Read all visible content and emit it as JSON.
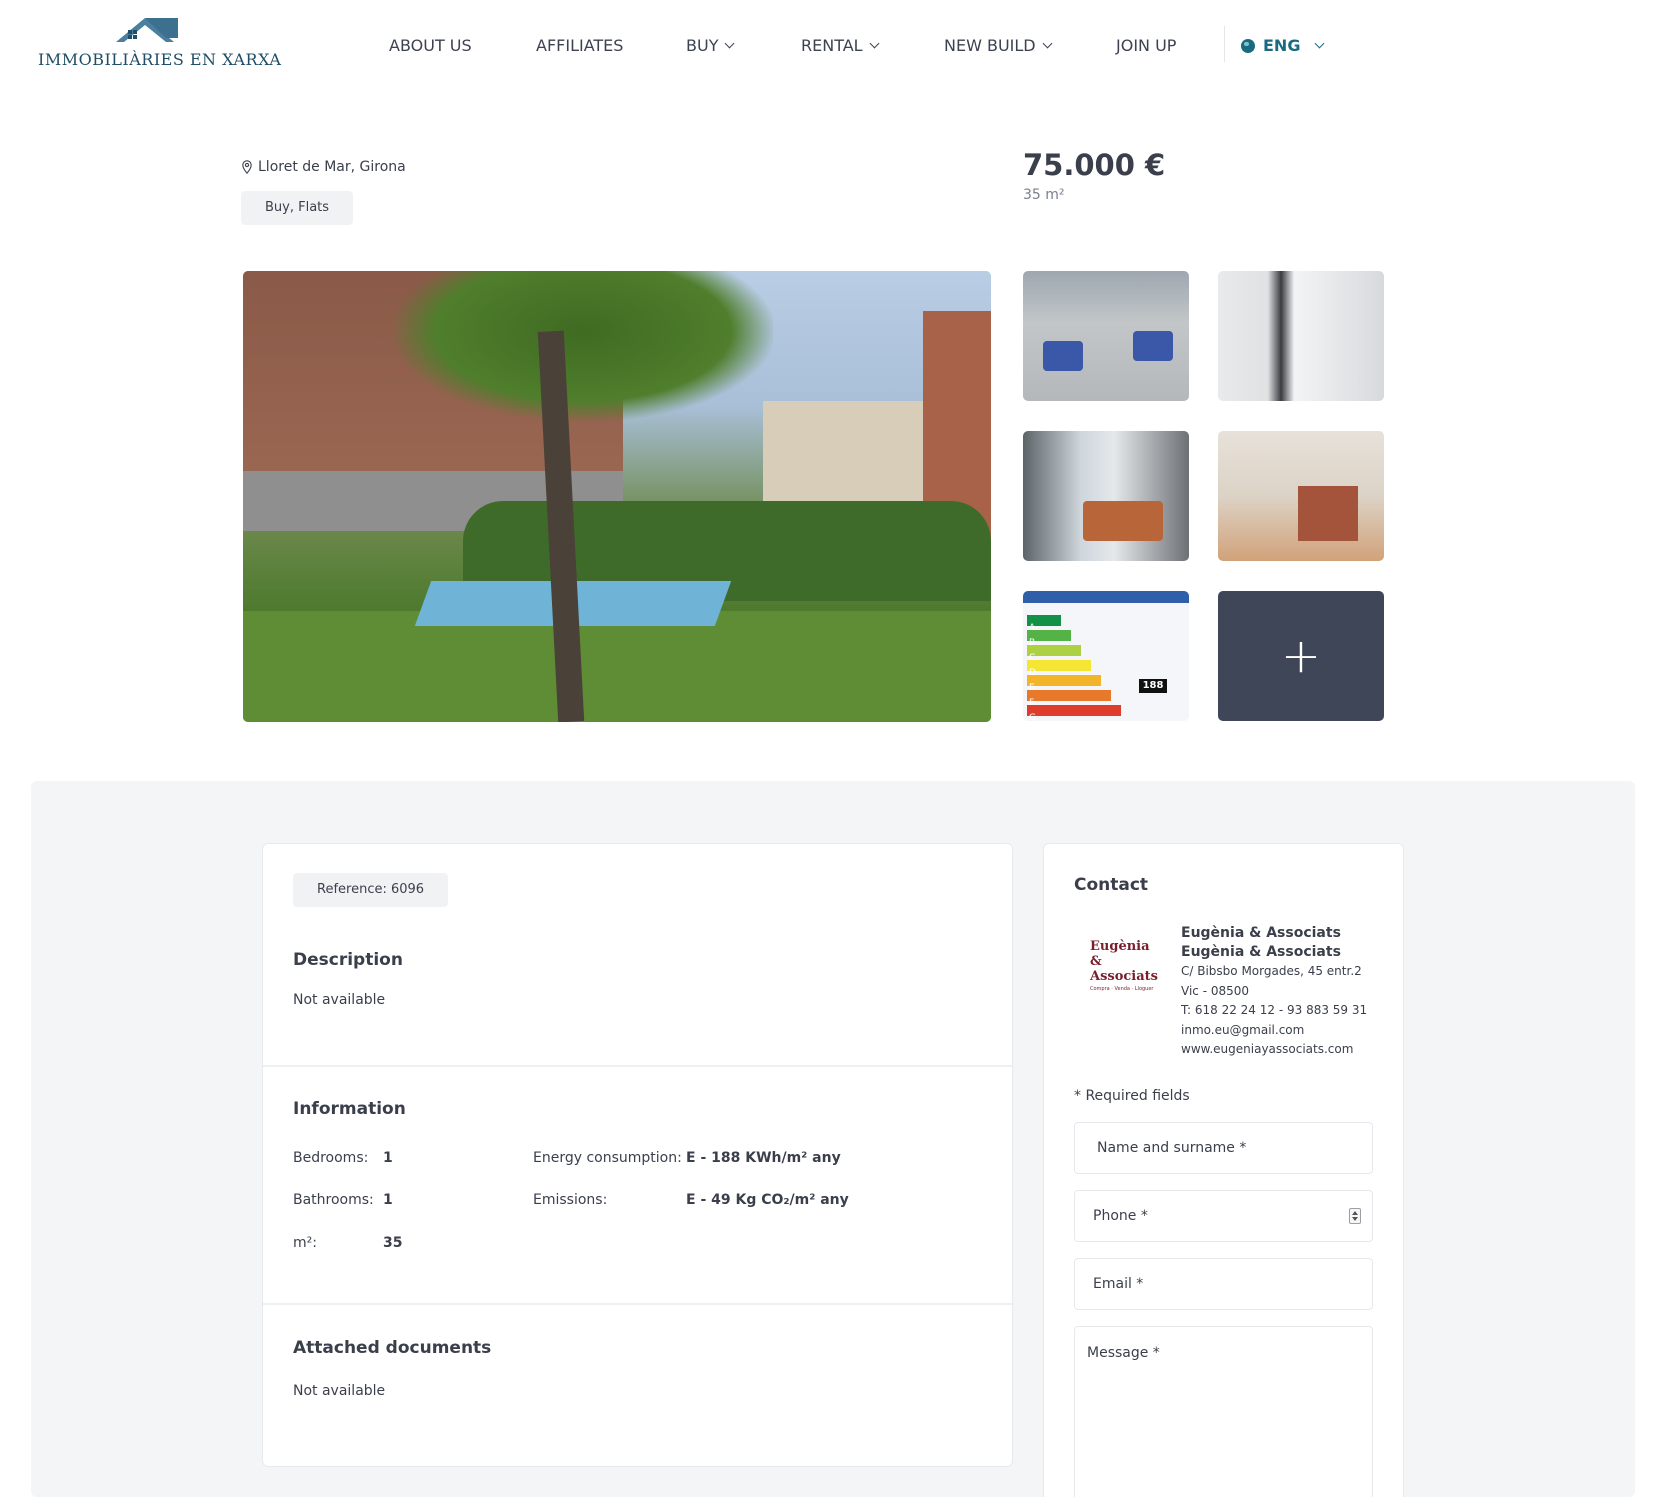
{
  "header": {
    "logo_text": "IMMOBILIÀRIES EN XARXA",
    "brand_color": "#1f4e68",
    "nav": [
      {
        "label": "ABOUT US",
        "dropdown": false
      },
      {
        "label": "AFFILIATES",
        "dropdown": false
      },
      {
        "label": "BUY",
        "dropdown": true
      },
      {
        "label": "RENTAL",
        "dropdown": true
      },
      {
        "label": "NEW BUILD",
        "dropdown": true
      },
      {
        "label": "JOIN UP",
        "dropdown": false
      }
    ],
    "language": {
      "label": "ENG",
      "icon": "globe-icon",
      "color": "#1a6b80"
    }
  },
  "property": {
    "location": "Lloret de Mar, Girona",
    "location_icon": "map-pin-icon",
    "tag": "Buy, Flats",
    "price": "75.000 €",
    "area": "35 m²"
  },
  "gallery": {
    "more_icon": "plus-icon",
    "energy_badge": "188",
    "energy_letters": [
      "A",
      "B",
      "C",
      "D",
      "E",
      "F",
      "G"
    ]
  },
  "details": {
    "reference": "Reference: 6096",
    "description": {
      "title": "Description",
      "text": "Not available"
    },
    "information": {
      "title": "Information",
      "bedrooms": {
        "label": "Bedrooms:",
        "value": "1"
      },
      "bathrooms": {
        "label": "Bathrooms:",
        "value": "1"
      },
      "area": {
        "label": "m²:",
        "value": "35"
      },
      "energy": {
        "label": "Energy consumption:",
        "value": "E - 188 KWh/m² any"
      },
      "emissions": {
        "label": "Emissions:",
        "value": "E - 49 Kg CO₂/m² any"
      }
    },
    "documents": {
      "title": "Attached documents",
      "text": "Not available"
    }
  },
  "contact": {
    "title": "Contact",
    "logo_line1": "Eugènia",
    "logo_line2": "& Associats",
    "logo_tagline": "Compra · Venda · Lloguer",
    "agency_name_1": "Eugènia & Associats",
    "agency_name_2": "Eugènia & Associats",
    "address": "C/ Bibsbo Morgades, 45 entr.2",
    "city": "Vic - 08500",
    "phone": "T: 618 22 24 12 - 93 883 59 31",
    "email": "inmo.eu@gmail.com",
    "website": "www.eugeniayassociats.com",
    "required_note": "* Required fields",
    "form": {
      "name_placeholder": "Name and surname *",
      "phone_placeholder": "Phone *",
      "email_placeholder": "Email *",
      "message_placeholder": "Message *"
    }
  }
}
